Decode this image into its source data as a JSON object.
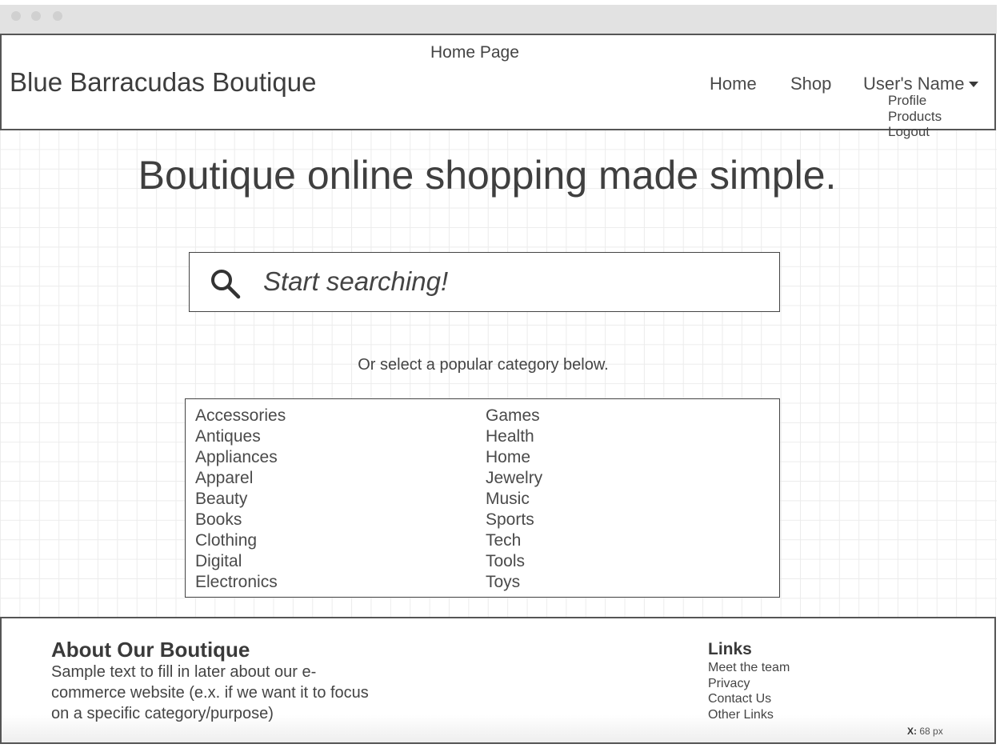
{
  "header": {
    "page_label": "Home Page",
    "brand": "Blue Barracudas Boutique",
    "nav": {
      "home": "Home",
      "shop": "Shop",
      "user": "User's Name"
    },
    "user_menu": [
      "Profile",
      "Products",
      "Logout"
    ]
  },
  "hero": {
    "title": "Boutique online shopping made simple."
  },
  "search": {
    "placeholder": "Start searching!",
    "icon": "search-icon"
  },
  "categories": {
    "prompt": "Or select a popular category below.",
    "column1": [
      "Accessories",
      "Antiques",
      "Appliances",
      "Apparel",
      "Beauty",
      "Books",
      "Clothing",
      "Digital",
      "Electronics"
    ],
    "column2": [
      "Games",
      "Health",
      "Home",
      "Jewelry",
      "Music",
      "Sports",
      "Tech",
      "Tools",
      "Toys"
    ]
  },
  "footer": {
    "about_title": "About Our Boutique",
    "about_text": "Sample text to fill in later about our e-commerce website (e.x. if we want it to focus on a specific category/purpose)",
    "links_title": "Links",
    "links": [
      "Meet the team",
      "Privacy",
      "Contact Us",
      "Other Links"
    ]
  },
  "readout": {
    "label": "X:",
    "value": "68",
    "unit": "px"
  },
  "colors": {
    "text": "#333333",
    "border": "#555555",
    "grid": "#ececec",
    "chrome": "#e2e2e2"
  }
}
